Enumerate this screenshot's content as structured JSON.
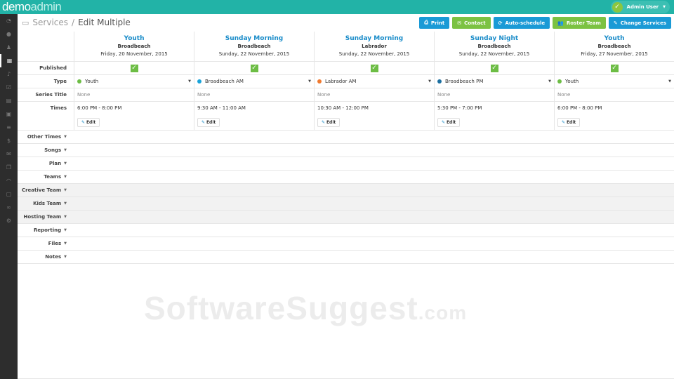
{
  "app": {
    "logo_a": "demo",
    "logo_b": "admin",
    "user": "Admin User"
  },
  "breadcrumb": {
    "parent": "Services",
    "current": "Edit Multiple"
  },
  "buttons": [
    {
      "label": "Print",
      "icon": "print-icon",
      "color": "blue"
    },
    {
      "label": "Contact",
      "icon": "envelope-icon",
      "color": "green"
    },
    {
      "label": "Auto-schedule",
      "icon": "refresh-icon",
      "color": "blue"
    },
    {
      "label": "Roster Team",
      "icon": "users-icon",
      "color": "green"
    },
    {
      "label": "Change Services",
      "icon": "pencil-icon",
      "color": "blue"
    }
  ],
  "row_labels": {
    "published": "Published",
    "type": "Type",
    "series": "Series Title",
    "times": "Times"
  },
  "services": [
    {
      "title": "Youth",
      "location": "Broadbeach",
      "date": "Friday, 20 November, 2015",
      "type": "Youth",
      "type_color": "#6dbd45",
      "series": "None",
      "times": "6:00 PM - 8:00 PM",
      "edit": "Edit"
    },
    {
      "title": "Sunday Morning",
      "location": "Broadbeach",
      "date": "Sunday, 22 November, 2015",
      "type": "Broadbeach AM",
      "type_color": "#1aa3d9",
      "series": "None",
      "times": "9:30 AM - 11:00 AM",
      "edit": "Edit"
    },
    {
      "title": "Sunday Morning",
      "location": "Labrador",
      "date": "Sunday, 22 November, 2015",
      "type": "Labrador AM",
      "type_color": "#f07a30",
      "series": "None",
      "times": "10:30 AM - 12:00 PM",
      "edit": "Edit"
    },
    {
      "title": "Sunday Night",
      "location": "Broadbeach",
      "date": "Sunday, 22 November, 2015",
      "type": "Broadbeach PM",
      "type_color": "#1c6fa0",
      "series": "None",
      "times": "5:30 PM - 7:00 PM",
      "edit": "Edit"
    },
    {
      "title": "Youth",
      "location": "Broadbeach",
      "date": "Friday, 27 November, 2015",
      "type": "Youth",
      "type_color": "#6dbd45",
      "series": "None",
      "times": "6:00 PM - 8:00 PM",
      "edit": "Edit"
    }
  ],
  "sections": [
    {
      "label": "Other Times",
      "shaded": false
    },
    {
      "label": "Songs",
      "shaded": false
    },
    {
      "label": "Plan",
      "shaded": false
    },
    {
      "label": "Teams",
      "shaded": false
    },
    {
      "label": "Creative Team",
      "shaded": true
    },
    {
      "label": "Kids Team",
      "shaded": true
    },
    {
      "label": "Hosting Team",
      "shaded": true
    },
    {
      "label": "Reporting",
      "shaded": false
    },
    {
      "label": "Files",
      "shaded": false
    },
    {
      "label": "Notes",
      "shaded": false
    }
  ],
  "sidebar": [
    "dashboard-icon",
    "user-icon",
    "group-icon",
    "calendar-icon",
    "music-icon",
    "checkbox-icon",
    "document-icon",
    "event-icon",
    "list-icon",
    "dollar-icon",
    "mail-icon",
    "copy-icon",
    "rss-icon",
    "file-icon",
    "link-icon",
    "settings-icon"
  ],
  "watermark": {
    "main": "SoftwareSuggest",
    "suffix": ".com"
  }
}
